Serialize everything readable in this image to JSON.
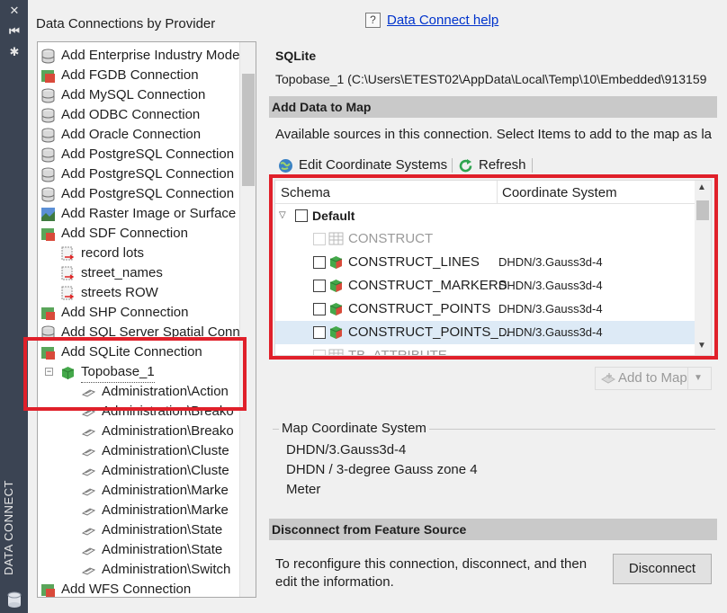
{
  "side_strip": {
    "vertical_label": "DATA CONNECT",
    "buttons": [
      "close-icon",
      "collapse-icon",
      "settings-icon"
    ]
  },
  "left_panel": {
    "title": "Data Connections by Provider",
    "items": [
      {
        "label": "Add Enterprise Industry Model",
        "icon": "database-icon",
        "indent": 0
      },
      {
        "label": "Add FGDB Connection",
        "icon": "fgdb-icon",
        "indent": 0
      },
      {
        "label": "Add MySQL Connection",
        "icon": "database-icon",
        "indent": 0
      },
      {
        "label": "Add ODBC Connection",
        "icon": "database-icon",
        "indent": 0
      },
      {
        "label": "Add Oracle Connection",
        "icon": "database-icon",
        "indent": 0
      },
      {
        "label": "Add PostgreSQL Connection",
        "icon": "database-icon",
        "indent": 0
      },
      {
        "label": "Add PostgreSQL Connection",
        "icon": "database-icon",
        "indent": 0
      },
      {
        "label": "Add PostgreSQL Connection",
        "icon": "database-icon",
        "indent": 0
      },
      {
        "label": "Add Raster Image or Surface",
        "icon": "raster-icon",
        "indent": 0
      },
      {
        "label": "Add SDF Connection",
        "icon": "sdf-icon",
        "indent": 0
      },
      {
        "label": "record lots",
        "icon": "file-link-icon",
        "indent": 1
      },
      {
        "label": "street_names",
        "icon": "file-link-icon",
        "indent": 1
      },
      {
        "label": "streets ROW",
        "icon": "file-link-icon",
        "indent": 1
      },
      {
        "label": "Add SHP Connection",
        "icon": "shp-icon",
        "indent": 0
      },
      {
        "label": "Add SQL Server Spatial Conn",
        "icon": "database-icon",
        "indent": 0
      },
      {
        "label": "Add SQLite Connection",
        "icon": "sqlite-icon",
        "indent": 0
      },
      {
        "label": "Topobase_1",
        "icon": "cube-icon",
        "indent": 1,
        "selected": true
      },
      {
        "label": "Administration\\Action",
        "icon": "feature-icon",
        "indent": 2
      },
      {
        "label": "Administration\\Breako",
        "icon": "feature-icon",
        "indent": 2
      },
      {
        "label": "Administration\\Breako",
        "icon": "feature-icon",
        "indent": 2
      },
      {
        "label": "Administration\\Cluste",
        "icon": "feature-icon",
        "indent": 2
      },
      {
        "label": "Administration\\Cluste",
        "icon": "feature-icon",
        "indent": 2
      },
      {
        "label": "Administration\\Marke",
        "icon": "feature-icon",
        "indent": 2
      },
      {
        "label": "Administration\\Marke",
        "icon": "feature-icon",
        "indent": 2
      },
      {
        "label": "Administration\\State",
        "icon": "feature-icon",
        "indent": 2
      },
      {
        "label": "Administration\\State",
        "icon": "feature-icon",
        "indent": 2
      },
      {
        "label": "Administration\\Switch",
        "icon": "feature-icon",
        "indent": 2
      },
      {
        "label": "Add WFS Connection",
        "icon": "wfs-icon",
        "indent": 0
      }
    ]
  },
  "help": {
    "label": "Data Connect help",
    "icon": "help-icon"
  },
  "connection": {
    "provider": "SQLite",
    "path": "Topobase_1 (C:\\Users\\ETEST02\\AppData\\Local\\Temp\\10\\Embedded\\913159"
  },
  "add_data": {
    "section_title": "Add Data to Map",
    "description": "Available sources in this connection.  Select Items to add to the map as la",
    "toolbar": {
      "edit_cs": "Edit Coordinate Systems",
      "refresh": "Refresh"
    },
    "columns": [
      "Schema",
      "Coordinate System"
    ],
    "schema_group": "Default",
    "rows": [
      {
        "name": "CONSTRUCT",
        "cs": "",
        "disabled": true
      },
      {
        "name": "CONSTRUCT_LINES",
        "cs": "DHDN/3.Gauss3d-4",
        "disabled": false
      },
      {
        "name": "CONSTRUCT_MARKERS",
        "cs": "DHDN/3.Gauss3d-4",
        "disabled": false
      },
      {
        "name": "CONSTRUCT_POINTS",
        "cs": "DHDN/3.Gauss3d-4",
        "disabled": false
      },
      {
        "name": "CONSTRUCT_POINTS_...",
        "cs": "DHDN/3.Gauss3d-4",
        "disabled": false,
        "highlighted": true
      },
      {
        "name": "TB_ATTRIBUTE",
        "cs": "",
        "disabled": true
      }
    ],
    "add_button": "Add to Map"
  },
  "map_cs": {
    "title": "Map Coordinate System",
    "code": "DHDN/3.Gauss3d-4",
    "name": "DHDN / 3-degree Gauss zone 4",
    "unit": "Meter"
  },
  "disconnect": {
    "section_title": "Disconnect from Feature Source",
    "text": "To reconfigure this connection, disconnect, and then edit the information.",
    "button": "Disconnect"
  },
  "colors": {
    "highlight_box": "#e0202a",
    "link": "#0033cc",
    "section_bar": "#c9c9c9",
    "strip": "#3b4453"
  }
}
